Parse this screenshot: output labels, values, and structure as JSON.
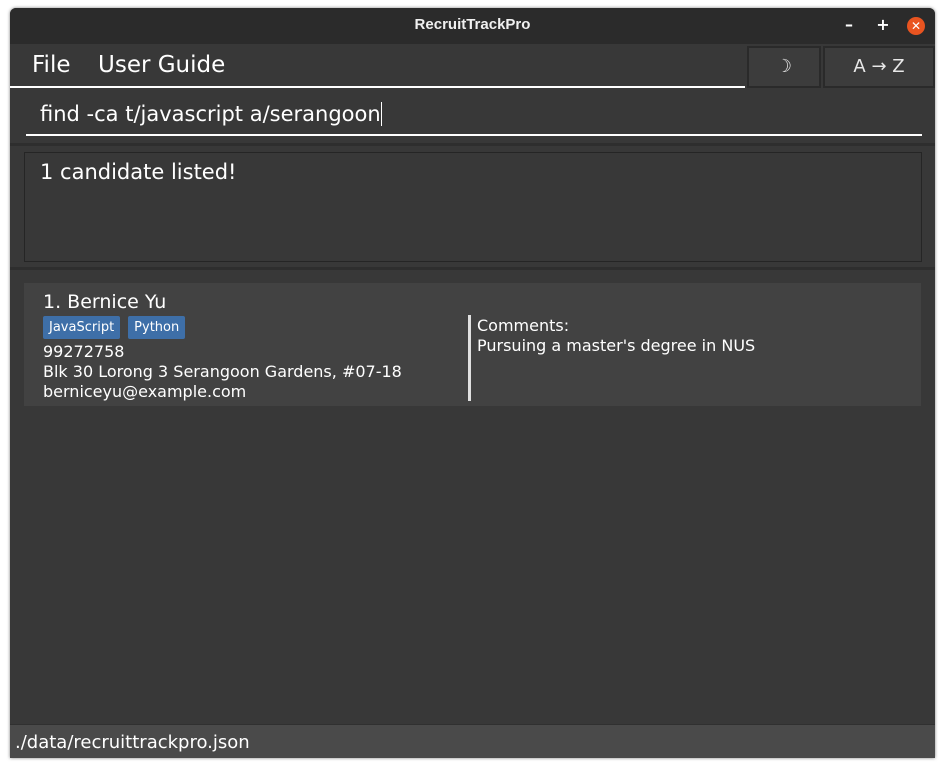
{
  "window": {
    "title": "RecruitTrackPro",
    "controls": {
      "minimize": "–",
      "maximize": "+",
      "close": "✕"
    }
  },
  "menu": {
    "file": "File",
    "user_guide": "User Guide"
  },
  "toolbar": {
    "theme_toggle": "☽",
    "sort": "A → Z"
  },
  "command": {
    "value": "find -ca t/javascript a/serangoon"
  },
  "result": {
    "message": "1 candidate listed!"
  },
  "candidates": [
    {
      "index_name": "1. Bernice Yu",
      "tags": [
        "JavaScript",
        "Python"
      ],
      "phone": "99272758",
      "address": "Blk 30 Lorong 3 Serangoon Gardens, #07-18",
      "email": "berniceyu@example.com",
      "comments_label": "Comments:",
      "comments": "Pursuing a master's degree in NUS"
    }
  ],
  "status": {
    "file_path": "./data/recruittrackpro.json"
  },
  "colors": {
    "tag_bg": "#3e6fa8",
    "close_button": "#e95420",
    "background": "#383838"
  }
}
